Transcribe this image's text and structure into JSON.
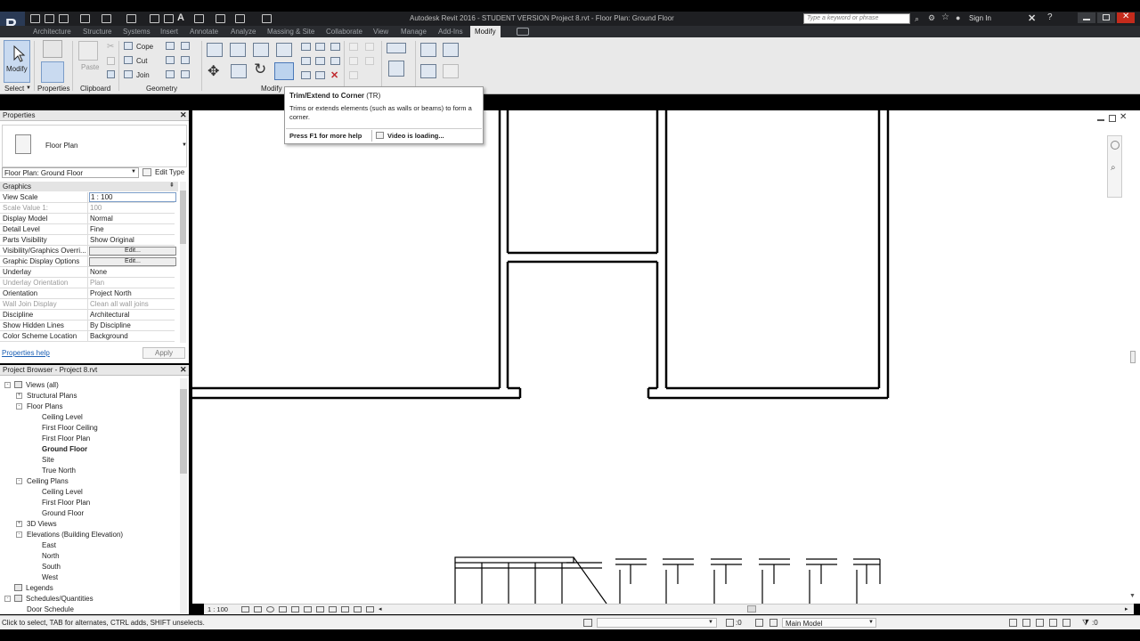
{
  "titlebar": {
    "title": "Autodesk Revit 2016 -  STUDENT VERSION    Project 8.rvt - Floor Plan: Ground Floor",
    "search_placeholder": "Type a keyword or phrase",
    "sign_in": "Sign In"
  },
  "ribbon_tabs": [
    "Architecture",
    "Structure",
    "Systems",
    "Insert",
    "Annotate",
    "Analyze",
    "Massing & Site",
    "Collaborate",
    "View",
    "Manage",
    "Add-Ins",
    "Modify"
  ],
  "ribbon": {
    "modify_label": "Modify",
    "paste_label": "Paste",
    "cope_label": "Cope",
    "cut_label": "Cut",
    "join_label": "Join",
    "panels": {
      "select": "Select",
      "properties": "Properties",
      "clipboard": "Clipboard",
      "geometry": "Geometry",
      "modify": "Modify"
    }
  },
  "tooltip": {
    "title": "Trim/Extend to Corner",
    "shortcut": "(TR)",
    "description": "Trims or extends elements (such as walls or beams) to form a corner.",
    "help": "Press F1 for more help",
    "video": "Video is loading..."
  },
  "properties": {
    "header": "Properties",
    "type_name": "Floor Plan",
    "selector_value": "Floor Plan: Ground Floor",
    "edit_type": "Edit Type",
    "group": "Graphics",
    "rows": [
      {
        "name": "View Scale",
        "value": "1 : 100"
      },
      {
        "name": "Scale Value    1:",
        "value": "100"
      },
      {
        "name": "Display Model",
        "value": "Normal"
      },
      {
        "name": "Detail Level",
        "value": "Fine"
      },
      {
        "name": "Parts Visibility",
        "value": "Show Original"
      },
      {
        "name": "Visibility/Graphics Overri...",
        "value": "Edit..."
      },
      {
        "name": "Graphic Display Options",
        "value": "Edit..."
      },
      {
        "name": "Underlay",
        "value": "None"
      },
      {
        "name": "Underlay Orientation",
        "value": "Plan"
      },
      {
        "name": "Orientation",
        "value": "Project North"
      },
      {
        "name": "Wall Join Display",
        "value": "Clean all wall joins"
      },
      {
        "name": "Discipline",
        "value": "Architectural"
      },
      {
        "name": "Show Hidden Lines",
        "value": "By Discipline"
      },
      {
        "name": "Color Scheme Location",
        "value": "Background"
      },
      {
        "name": "Color Scheme",
        "value": ""
      }
    ],
    "help_link": "Properties help",
    "apply": "Apply"
  },
  "project_browser": {
    "header": "Project Browser - Project 8.rvt",
    "items": [
      {
        "label": "Views (all)",
        "toggle": "-"
      },
      {
        "label": "Structural Plans",
        "toggle": "+"
      },
      {
        "label": "Floor Plans",
        "toggle": "-"
      },
      {
        "label": "Ceiling Level",
        "toggle": ""
      },
      {
        "label": "First Floor Ceiling",
        "toggle": ""
      },
      {
        "label": "First Floor Plan",
        "toggle": ""
      },
      {
        "label": "Ground Floor",
        "toggle": ""
      },
      {
        "label": "Site",
        "toggle": ""
      },
      {
        "label": "True North",
        "toggle": ""
      },
      {
        "label": "Ceiling Plans",
        "toggle": "-"
      },
      {
        "label": "Ceiling Level",
        "toggle": ""
      },
      {
        "label": "First Floor Plan",
        "toggle": ""
      },
      {
        "label": "Ground Floor",
        "toggle": ""
      },
      {
        "label": "3D Views",
        "toggle": "+"
      },
      {
        "label": "Elevations (Building Elevation)",
        "toggle": "-"
      },
      {
        "label": "East",
        "toggle": ""
      },
      {
        "label": "North",
        "toggle": ""
      },
      {
        "label": "South",
        "toggle": ""
      },
      {
        "label": "West",
        "toggle": ""
      },
      {
        "label": "Legends",
        "toggle": ""
      },
      {
        "label": "Schedules/Quantities",
        "toggle": "-"
      },
      {
        "label": "Door Schedule",
        "toggle": ""
      }
    ]
  },
  "view_control_bar": {
    "scale": "1 : 100"
  },
  "statusbar": {
    "message": "Click to select, TAB for alternates, CTRL adds, SHIFT unselects.",
    "selection_count": ":0",
    "model": "Main Model",
    "filter_count": ":0"
  },
  "colors": {
    "dark_chrome": "#1e1f22",
    "ribbon_bg": "#e9e9e9",
    "canvas_bg": "#ffffff",
    "selection_blue": "#c9daf0"
  }
}
